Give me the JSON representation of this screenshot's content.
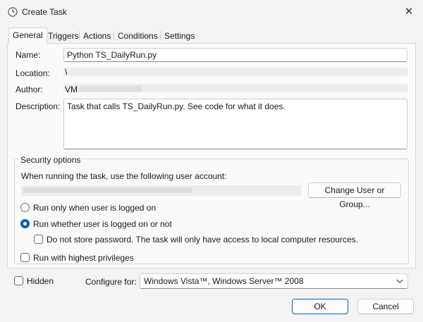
{
  "window": {
    "title": "Create Task",
    "close_glyph": "✕",
    "icon": "clock-icon"
  },
  "tabs": [
    {
      "label": "General",
      "active": true
    },
    {
      "label": "Triggers"
    },
    {
      "label": "Actions"
    },
    {
      "label": "Conditions"
    },
    {
      "label": "Settings"
    }
  ],
  "general": {
    "name_label": "Name:",
    "name_value": "Python TS_DailyRun.py",
    "location_label": "Location:",
    "location_value": "\\",
    "author_label": "Author:",
    "author_value": "VM",
    "description_label": "Description:",
    "description_value": "Task that calls TS_DailyRun.py. See code for what it does."
  },
  "security": {
    "title": "Security options",
    "account_prompt": "When running the task, use the following user account:",
    "change_user_button": "Change User or Group...",
    "run_logged_on_label": "Run only when user is logged on",
    "run_whether_label": "Run whether user is logged on or not",
    "no_store_password_label": "Do not store password.  The task will only have access to local computer resources.",
    "highest_privileges_label": "Run with highest privileges",
    "selected_run_option": "Run whether user is logged on or not"
  },
  "footer_options": {
    "hidden_label": "Hidden",
    "configure_for_label": "Configure for:",
    "configure_for_value": "Windows Vista™, Windows Server™ 2008"
  },
  "buttons": {
    "ok": "OK",
    "cancel": "Cancel"
  },
  "colors": {
    "accent": "#005fb8",
    "primary_border": "#0067c0"
  }
}
